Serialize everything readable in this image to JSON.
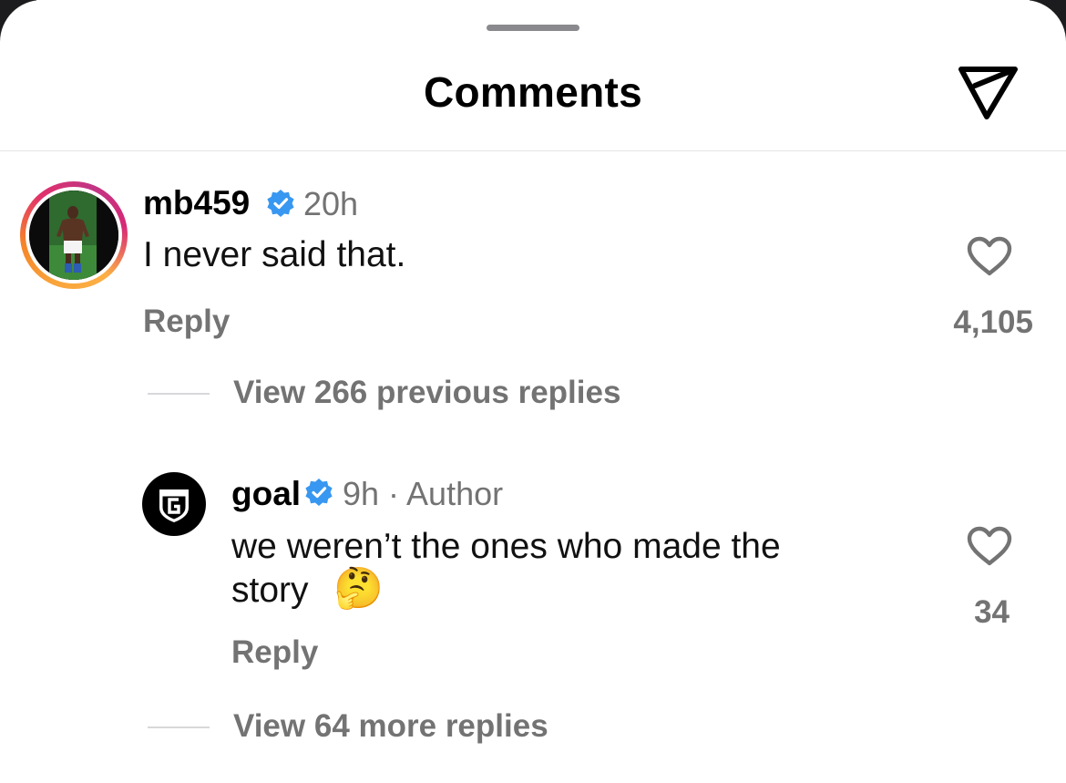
{
  "header": {
    "title": "Comments"
  },
  "comments": [
    {
      "username": "mb459",
      "time": "20h",
      "text": "I never said that.",
      "reply_label": "Reply",
      "likes": "4,105",
      "view_replies": "View 266 previous replies"
    },
    {
      "username": "goal",
      "time": "9h · Author",
      "text_line1": "we weren’t the ones who made the",
      "text_line2": "story",
      "emoji": "🤔",
      "reply_label": "Reply",
      "likes": "34",
      "view_replies": "View 64 more replies"
    }
  ],
  "colors": {
    "verified": "#3897f0",
    "muted": "#737373"
  },
  "icons": [
    "share-icon",
    "heart-icon",
    "verified-badge-icon",
    "goal-logo-icon"
  ]
}
